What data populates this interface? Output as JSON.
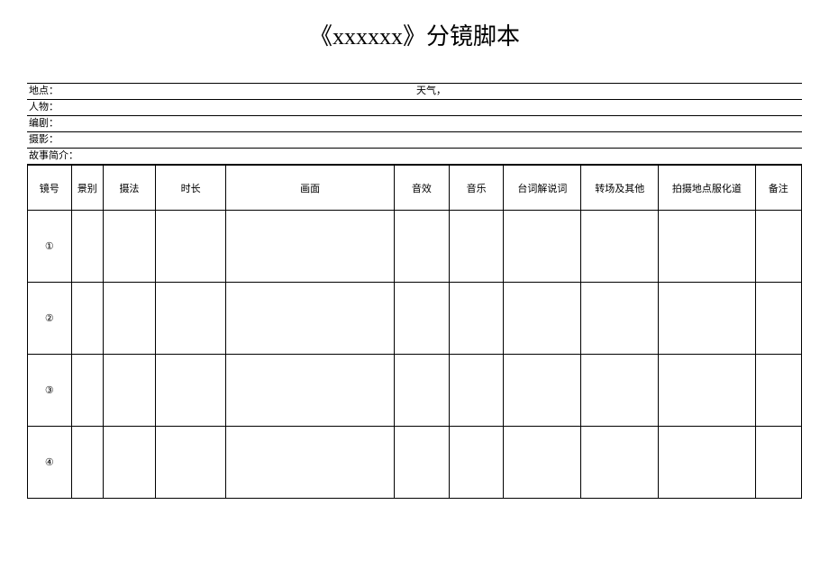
{
  "title": "《xxxxxx》分镜脚本",
  "info": {
    "location_label": "地点：",
    "location_value": "",
    "weather_label": "天气，",
    "weather_value": "",
    "characters_label": "人物：",
    "characters_value": "",
    "writer_label": "编剧：",
    "writer_value": "",
    "photographer_label": "摄影：",
    "photographer_value": "",
    "synopsis_label": "故事简介：",
    "synopsis_value": ""
  },
  "headers": {
    "shot_no": "镜号",
    "shot_type": "景别",
    "method": "摄法",
    "duration": "时长",
    "screen": "画面",
    "sound": "音效",
    "music": "音乐",
    "dialog": "台词解说词",
    "transition": "转场及其他",
    "location": "拍摄地点服化道",
    "note": "备注"
  },
  "rows": [
    {
      "no": "①",
      "type": "",
      "method": "",
      "duration": "",
      "screen": "",
      "sound": "",
      "music": "",
      "dialog": "",
      "transition": "",
      "location": "",
      "note": ""
    },
    {
      "no": "②",
      "type": "",
      "method": "",
      "duration": "",
      "screen": "",
      "sound": "",
      "music": "",
      "dialog": "",
      "transition": "",
      "location": "",
      "note": ""
    },
    {
      "no": "③",
      "type": "",
      "method": "",
      "duration": "",
      "screen": "",
      "sound": "",
      "music": "",
      "dialog": "",
      "transition": "",
      "location": "",
      "note": ""
    },
    {
      "no": "④",
      "type": "",
      "method": "",
      "duration": "",
      "screen": "",
      "sound": "",
      "music": "",
      "dialog": "",
      "transition": "",
      "location": "",
      "note": ""
    }
  ]
}
